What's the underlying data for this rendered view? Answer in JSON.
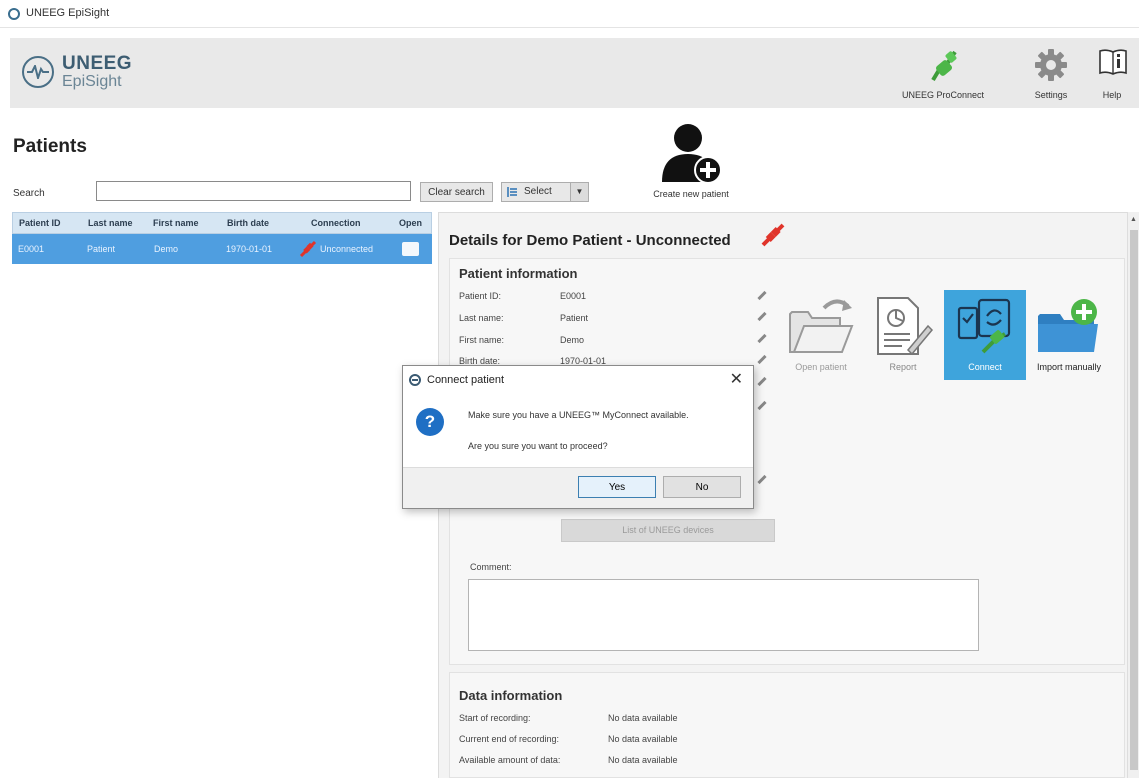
{
  "window": {
    "title": "UNEEG EpiSight"
  },
  "header": {
    "logo_line1": "UNEEG",
    "logo_line2": "EpiSight",
    "proconnect_label": "UNEEG ProConnect",
    "settings_label": "Settings",
    "help_label": "Help"
  },
  "patients": {
    "title": "Patients",
    "search_label": "Search",
    "search_value": "",
    "clear_search_label": "Clear search",
    "select_label": "Select",
    "create_new_label": "Create new patient",
    "columns": [
      "Patient ID",
      "Last name",
      "First name",
      "Birth date",
      "Connection",
      "Open"
    ],
    "rows": [
      {
        "patient_id": "E0001",
        "last_name": "Patient",
        "first_name": "Demo",
        "birth_date": "1970-01-01",
        "connection": "Unconnected"
      }
    ]
  },
  "details": {
    "title": "Details for Demo Patient - Unconnected",
    "patient_info_title": "Patient information",
    "fields": [
      {
        "label": "Patient ID:",
        "value": "E0001"
      },
      {
        "label": "Last name:",
        "value": "Patient"
      },
      {
        "label": "First name:",
        "value": "Demo"
      },
      {
        "label": "Birth date:",
        "value": "1970-01-01"
      }
    ],
    "actions": {
      "open_patient": "Open patient",
      "report": "Report",
      "connect": "Connect",
      "import_manually": "Import manually"
    },
    "list_devices_label": "List of UNEEG devices",
    "comment_label": "Comment:",
    "comment_value": "",
    "data_info_title": "Data information",
    "data_fields": [
      {
        "label": "Start of recording:",
        "value": "No data available"
      },
      {
        "label": "Current end of recording:",
        "value": "No data available"
      },
      {
        "label": "Available amount of data:",
        "value": "No data available"
      }
    ]
  },
  "dialog": {
    "title": "Connect patient",
    "message1": "Make sure you have a UNEEG™ MyConnect available.",
    "message2": "Are you sure you want to proceed?",
    "yes_label": "Yes",
    "no_label": "No"
  },
  "colors": {
    "selection": "#4f9ee0",
    "connect_tile": "#3ea4dc",
    "proconnect_green": "#4cb648",
    "unconnected_red": "#e0342a",
    "dialog_question": "#1f6fc4"
  },
  "icons": [
    "app-icon",
    "uneeg-logo-icon",
    "plug-green-icon",
    "gear-icon",
    "help-book-icon",
    "add-user-icon",
    "list-icon",
    "chevron-down-icon",
    "plug-red-icon",
    "folder-icon",
    "pencil-icon",
    "report-icon",
    "connect-device-icon",
    "import-icon",
    "question-icon",
    "close-icon"
  ]
}
